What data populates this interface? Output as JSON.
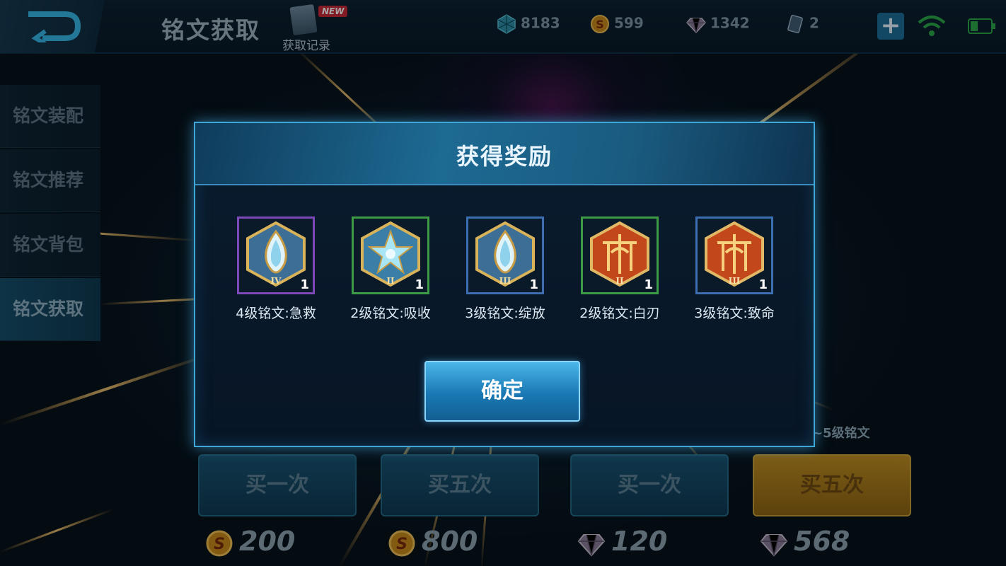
{
  "top_bar": {
    "title": "铭文获取",
    "record_label": "获取记录",
    "new_badge": "NEW",
    "currencies": [
      {
        "icon": "crystal-icon",
        "value": "8183"
      },
      {
        "icon": "gold-coin-icon",
        "value": "599"
      },
      {
        "icon": "diamond-icon",
        "value": "1342"
      },
      {
        "icon": "card-icon",
        "value": "2"
      }
    ]
  },
  "sidebar": {
    "items": [
      {
        "label": "铭文装配",
        "active": false
      },
      {
        "label": "铭文推荐",
        "active": false
      },
      {
        "label": "铭文背包",
        "active": false
      },
      {
        "label": "铭文获取",
        "active": true
      }
    ]
  },
  "shop": {
    "note": "~5级铭文",
    "buttons": [
      {
        "label": "买一次",
        "price": "200",
        "currency_icon": "gold-coin-icon"
      },
      {
        "label": "买五次",
        "price": "800",
        "currency_icon": "gold-coin-icon"
      },
      {
        "label": "买一次",
        "price": "120",
        "currency_icon": "diamond-icon"
      },
      {
        "label": "买五次",
        "price": "568",
        "currency_icon": "diamond-icon"
      }
    ]
  },
  "modal": {
    "title": "获得奖励",
    "confirm_label": "确定",
    "rewards": [
      {
        "name": "4级铭文:急救",
        "count": "1",
        "rank": "IV",
        "color": "blue",
        "frame": "purple",
        "icon": "teardrop-rune-icon"
      },
      {
        "name": "2级铭文:吸收",
        "count": "1",
        "rank": "II",
        "color": "blue",
        "frame": "green",
        "icon": "star-rune-icon"
      },
      {
        "name": "3级铭文:绽放",
        "count": "1",
        "rank": "III",
        "color": "blue",
        "frame": "blue",
        "icon": "teardrop-rune-icon"
      },
      {
        "name": "2级铭文:白刃",
        "count": "1",
        "rank": "II",
        "color": "red",
        "frame": "green",
        "icon": "pillar-rune-icon"
      },
      {
        "name": "3级铭文:致命",
        "count": "1",
        "rank": "III",
        "color": "red",
        "frame": "blue",
        "icon": "pillar-rune-icon"
      }
    ]
  },
  "colors": {
    "accent": "#3fa6d8",
    "confirm": "#1a78b4",
    "gold_button": "#c08f22"
  }
}
